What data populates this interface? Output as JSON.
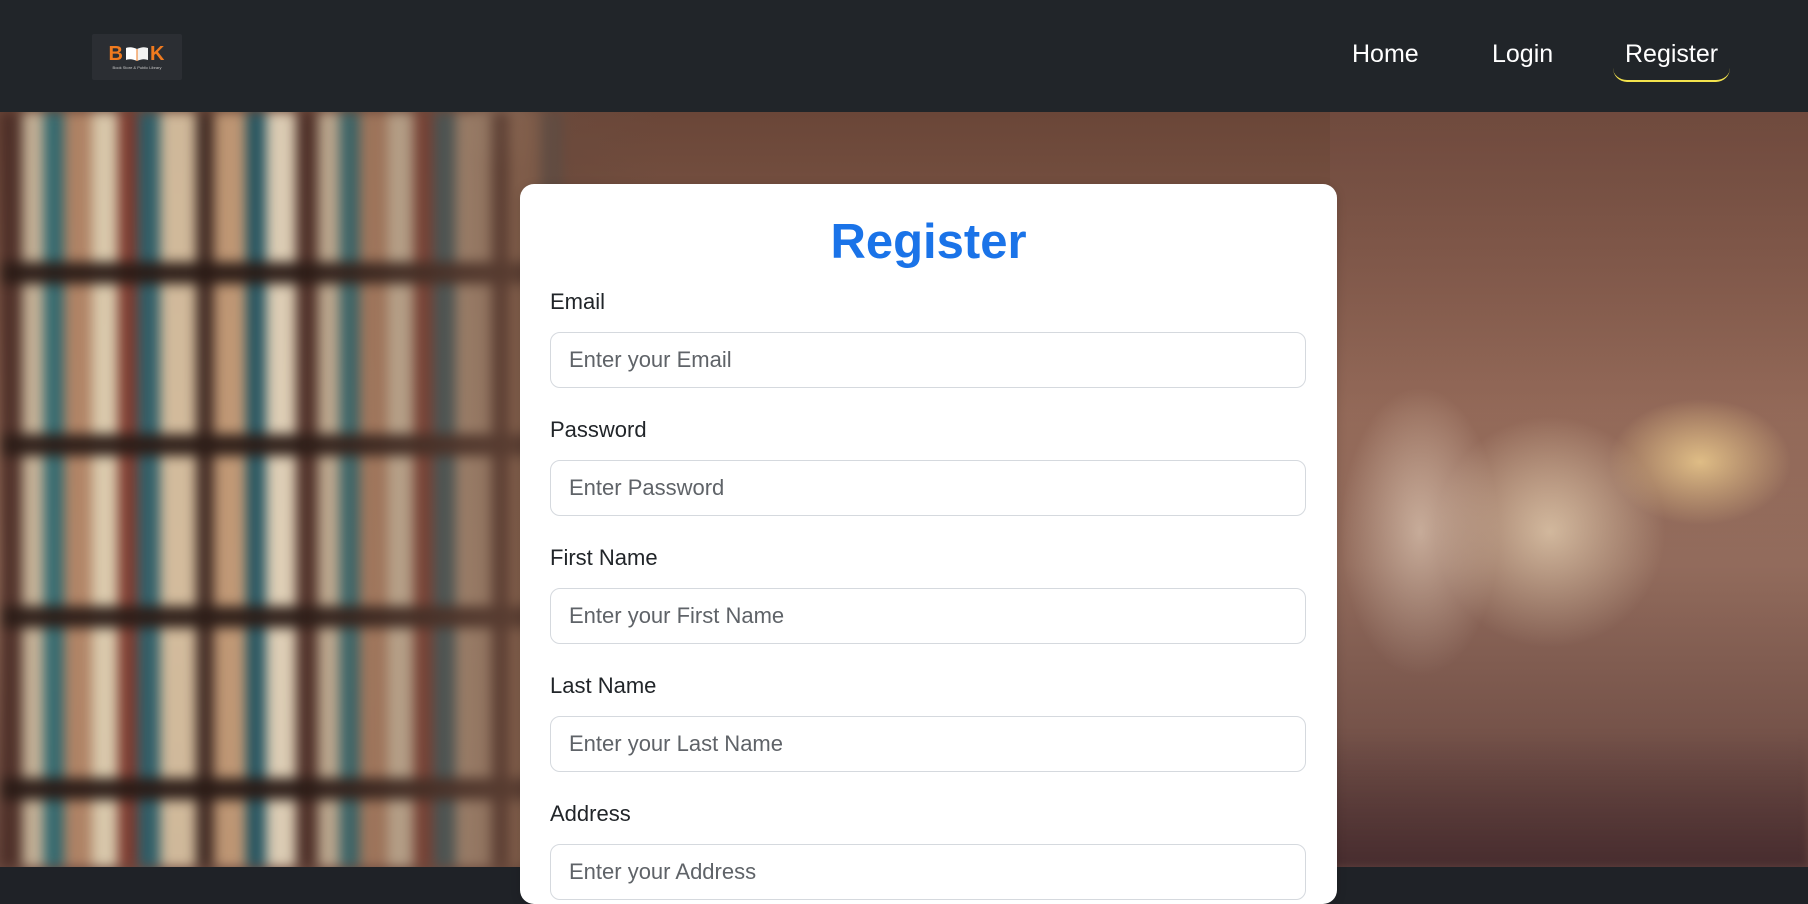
{
  "brand": {
    "logo_text": "BOOK",
    "logo_prefix": "B",
    "logo_suffix": "K",
    "tagline": "Book Store & Public Library",
    "accent_color": "#f07a1e"
  },
  "nav": {
    "items": [
      {
        "label": "Home",
        "active": false
      },
      {
        "label": "Login",
        "active": false
      },
      {
        "label": "Register",
        "active": true
      }
    ]
  },
  "form": {
    "title": "Register",
    "title_color": "#1a73e8",
    "fields": [
      {
        "label": "Email",
        "placeholder": "Enter your Email",
        "value": ""
      },
      {
        "label": "Password",
        "placeholder": "Enter Password",
        "value": ""
      },
      {
        "label": "First Name",
        "placeholder": "Enter your First Name",
        "value": ""
      },
      {
        "label": "Last Name",
        "placeholder": "Enter your Last Name",
        "value": ""
      },
      {
        "label": "Address",
        "placeholder": "Enter your Address",
        "value": ""
      }
    ]
  }
}
